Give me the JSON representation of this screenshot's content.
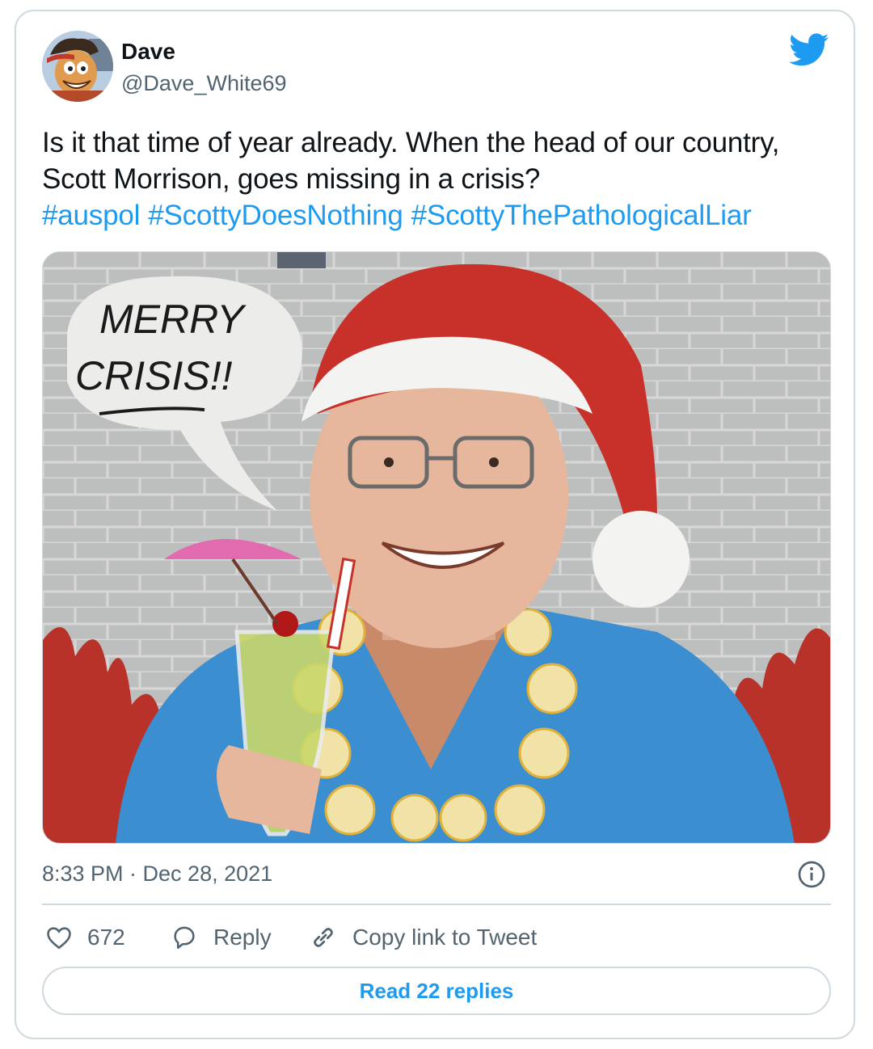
{
  "author": {
    "display_name": "Dave",
    "handle": "@Dave_White69"
  },
  "tweet": {
    "text_line1": "Is it that time of year already. When the head of our country,",
    "text_line2": "Scott Morrison, goes missing in a crisis?",
    "hashtags": [
      "#auspol",
      "#ScottyDoesNothing",
      "#ScottyThePathologicalLiar"
    ]
  },
  "media": {
    "speech_bubble_line1": "MERRY",
    "speech_bubble_line2": "CRISIS!!"
  },
  "meta": {
    "timestamp": "8:33 PM · Dec 28, 2021"
  },
  "actions": {
    "like_count": "672",
    "reply_label": "Reply",
    "copy_link_label": "Copy link to Tweet"
  },
  "footer": {
    "read_replies_label": "Read 22 replies"
  },
  "colors": {
    "accent": "#1d9bf0",
    "secondary_text": "#536471",
    "border": "#cfd9de"
  },
  "icons": [
    "twitter-bird-icon",
    "info-icon",
    "heart-icon",
    "reply-bubble-icon",
    "link-icon"
  ]
}
